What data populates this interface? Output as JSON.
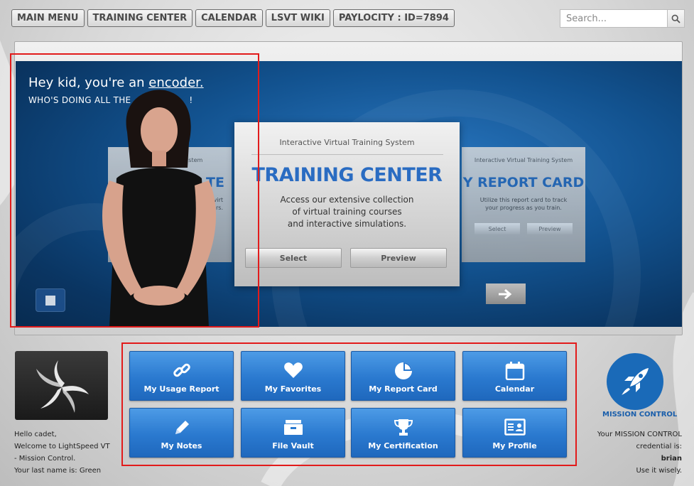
{
  "nav": {
    "items": [
      "MAIN MENU",
      "TRAINING CENTER",
      "CALENDAR",
      "LSVT WIKI",
      "PAYLOCITY : ID=7894"
    ]
  },
  "search": {
    "placeholder": "Search...",
    "icon": "search-icon"
  },
  "stage": {
    "headline_prefix": "Hey kid, you're an ",
    "headline_link": "encoder.",
    "subline": "WHO'S DOING ALL THE",
    "subline_end": "!",
    "left_card": {
      "subtitle": "Virtual Training System",
      "title": "TE",
      "desc_lines": [
        "virt",
        "rs."
      ]
    },
    "center_card": {
      "subtitle": "Interactive Virtual Training System",
      "title": "TRAINING CENTER",
      "desc_lines": [
        "Access our extensive collection",
        "of virtual training courses",
        "and interactive simulations."
      ],
      "select_label": "Select",
      "preview_label": "Preview"
    },
    "right_card": {
      "subtitle": "Interactive Virtual Training System",
      "title": "Y REPORT CARD",
      "desc_lines": [
        "Utilize this report card to track",
        "your progress as you train."
      ],
      "select_label": "Select",
      "preview_label": "Preview"
    }
  },
  "tiles": [
    {
      "label": "My Usage Report",
      "icon": "link-icon"
    },
    {
      "label": "My Favorites",
      "icon": "heart-icon"
    },
    {
      "label": "My Report Card",
      "icon": "pie-chart-icon"
    },
    {
      "label": "Calendar",
      "icon": "calendar-icon"
    },
    {
      "label": "My Notes",
      "icon": "pencil-icon"
    },
    {
      "label": "File Vault",
      "icon": "archive-icon"
    },
    {
      "label": "My Certification",
      "icon": "trophy-icon"
    },
    {
      "label": "My Profile",
      "icon": "id-card-icon"
    }
  ],
  "welcome": {
    "line1": "Hello cadet,",
    "line2": "Welcome to LightSpeed VT",
    "line3": "- Mission Control.",
    "line4": "Your last name is: Green"
  },
  "mission": {
    "label": "MISSION CONTROL",
    "cred_line1": "Your MISSION CONTROL",
    "cred_line2": "credential is:",
    "credential": "brian",
    "cred_line4": "Use it wisely."
  },
  "colors": {
    "tile": "#2a79cf",
    "highlight": "#e21b1b",
    "brand": "#2a6cc2"
  }
}
